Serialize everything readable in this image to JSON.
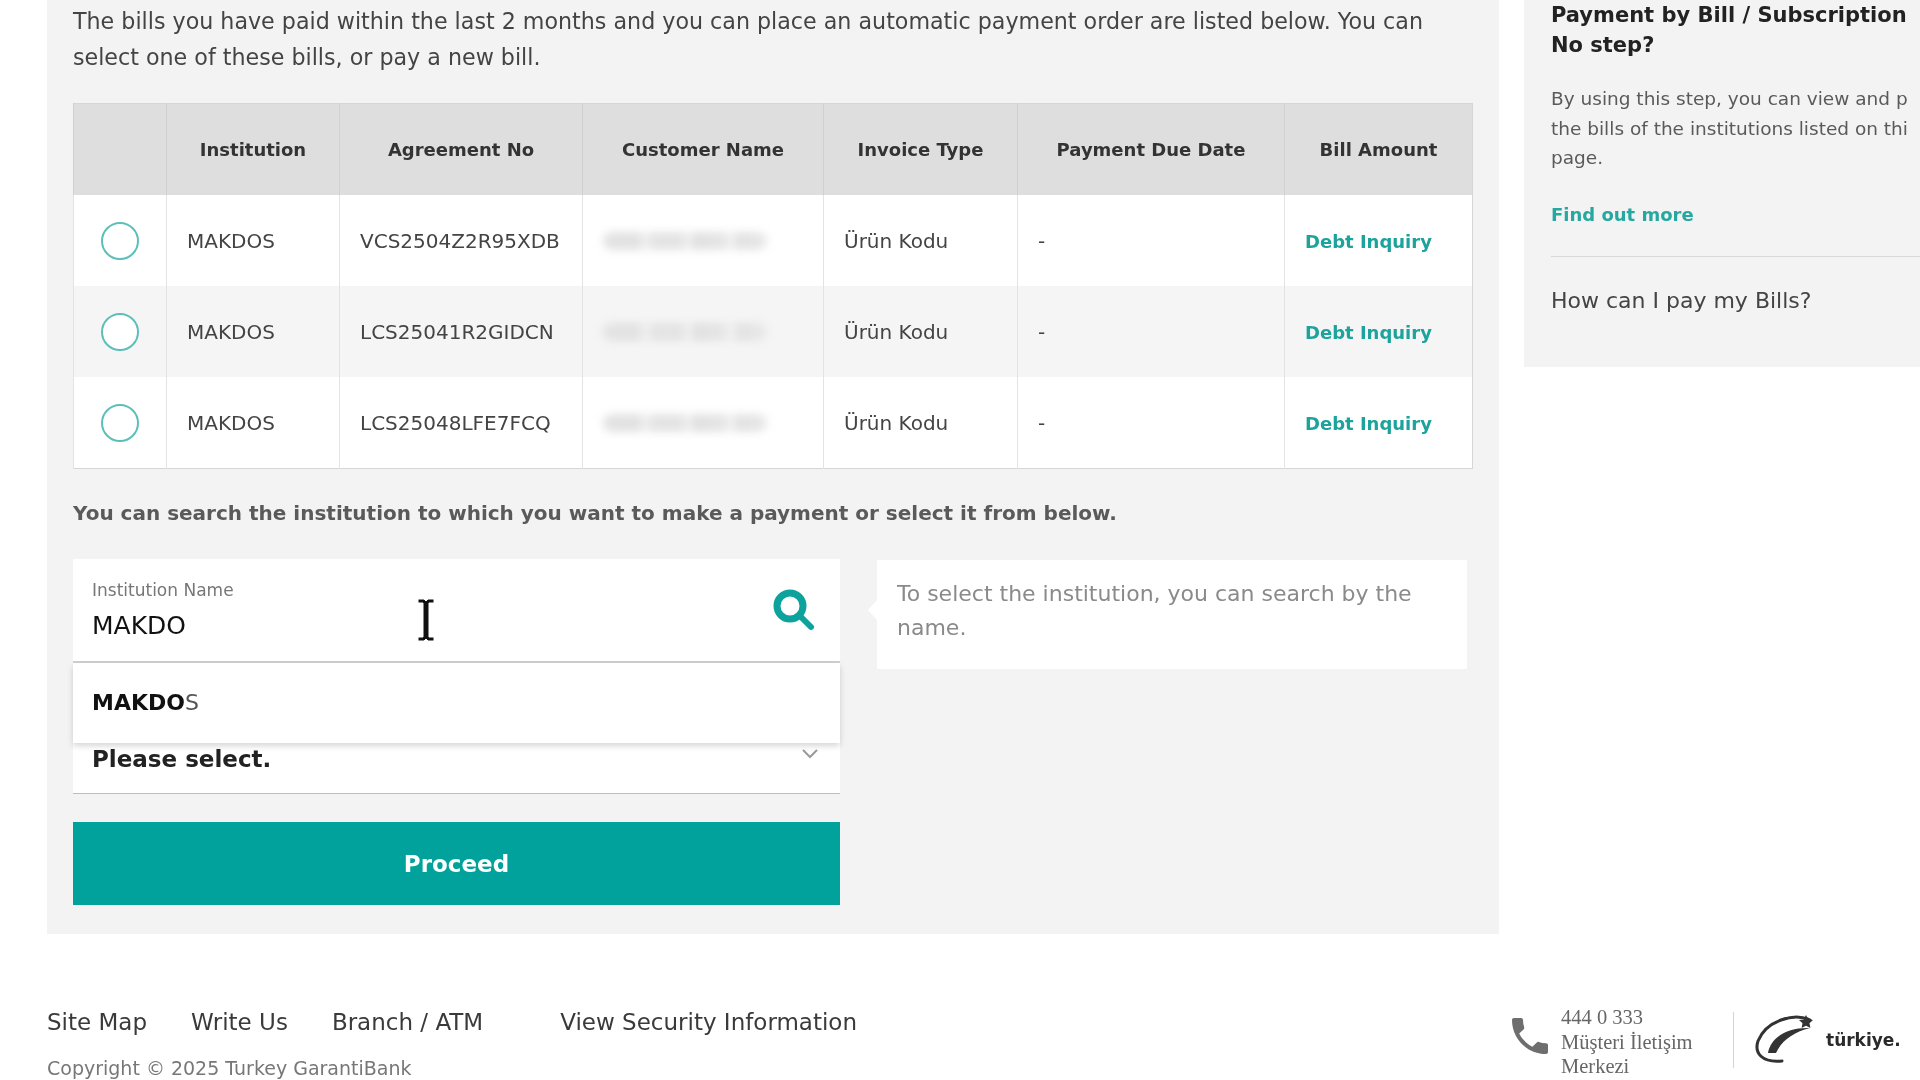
{
  "intro": "The bills you have paid within the last 2 months and you can place an automatic payment order are listed below. You can select one of these bills, or pay a new bill.",
  "bills_table": {
    "columns": [
      "Institution",
      "Agreement No",
      "Customer Name",
      "Invoice Type",
      "Payment Due Date",
      "Bill Amount"
    ],
    "rows": [
      {
        "selected": false,
        "institution": "MAKDOS",
        "agreement_no": "VCS2504Z2R95XDB",
        "customer_name_blurred": true,
        "invoice_type": "Ürün Kodu",
        "payment_due_date": "-",
        "bill_amount_link": "Debt Inquiry"
      },
      {
        "selected": false,
        "institution": "MAKDOS",
        "agreement_no": "LCS25041R2GIDCN",
        "customer_name_blurred": true,
        "invoice_type": "Ürün Kodu",
        "payment_due_date": "-",
        "bill_amount_link": "Debt Inquiry"
      },
      {
        "selected": false,
        "institution": "MAKDOS",
        "agreement_no": "LCS25048LFE7FCQ",
        "customer_name_blurred": true,
        "invoice_type": "Ürün Kodu",
        "payment_due_date": "-",
        "bill_amount_link": "Debt Inquiry"
      }
    ]
  },
  "search_hint": "You can search the institution to which you want to make a payment or select it from below.",
  "institution_field": {
    "label": "Institution Name",
    "value": "MAKDO"
  },
  "suggestions": [
    {
      "text": "**MAKDO**S"
    }
  ],
  "institution_select": {
    "value": "Please select."
  },
  "tooltip": "To select the institution, you can search by the name.",
  "proceed_button": "Proceed",
  "sidebar": {
    "title_lines": [
      "Payment by Bill / Subscription",
      "No step?"
    ],
    "description_lines": [
      "By using this step, you can view and p",
      "the bills of the institutions listed on thi",
      "page."
    ],
    "link": "Find out more",
    "faq": [
      "How can I pay my Bills?"
    ]
  },
  "footer": {
    "links": [
      "Site Map",
      "Write Us",
      "Branch / ATM",
      "View Security Information"
    ],
    "copyright": "Copyright © 2025 Turkey GarantiBank",
    "hotline": {
      "number": "444 0 333",
      "caption_lines": [
        "Müşteri İletişim",
        "Merkezi"
      ]
    },
    "logo_text": "türkiye."
  }
}
